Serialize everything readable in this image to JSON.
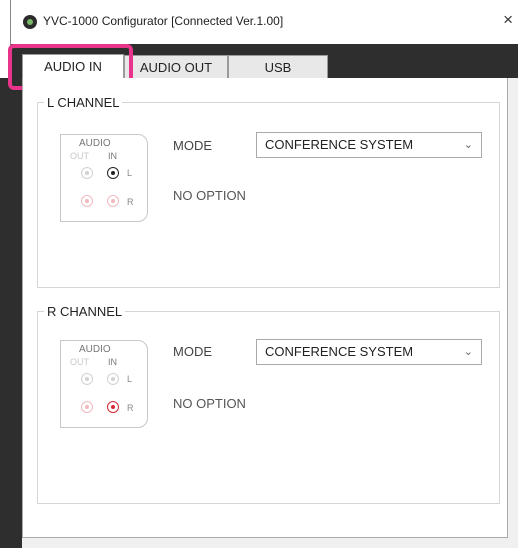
{
  "window": {
    "title": "YVC-1000 Configurator  [Connected  Ver.1.00]",
    "close_label": "×"
  },
  "tabs": [
    {
      "label": "AUDIO IN",
      "active": true
    },
    {
      "label": "AUDIO OUT",
      "active": false
    },
    {
      "label": "USB",
      "active": false
    }
  ],
  "highlight_color": "#e8348a",
  "channels": [
    {
      "title": "L CHANNEL",
      "diagram": {
        "audio": "AUDIO",
        "out": "OUT",
        "in": "IN",
        "l": "L",
        "r": "R",
        "selected": "L"
      },
      "mode_label": "MODE",
      "mode_value": "CONFERENCE SYSTEM",
      "option_text": "NO OPTION"
    },
    {
      "title": "R CHANNEL",
      "diagram": {
        "audio": "AUDIO",
        "out": "OUT",
        "in": "IN",
        "l": "L",
        "r": "R",
        "selected": "R"
      },
      "mode_label": "MODE",
      "mode_value": "CONFERENCE SYSTEM",
      "option_text": "NO OPTION"
    }
  ]
}
